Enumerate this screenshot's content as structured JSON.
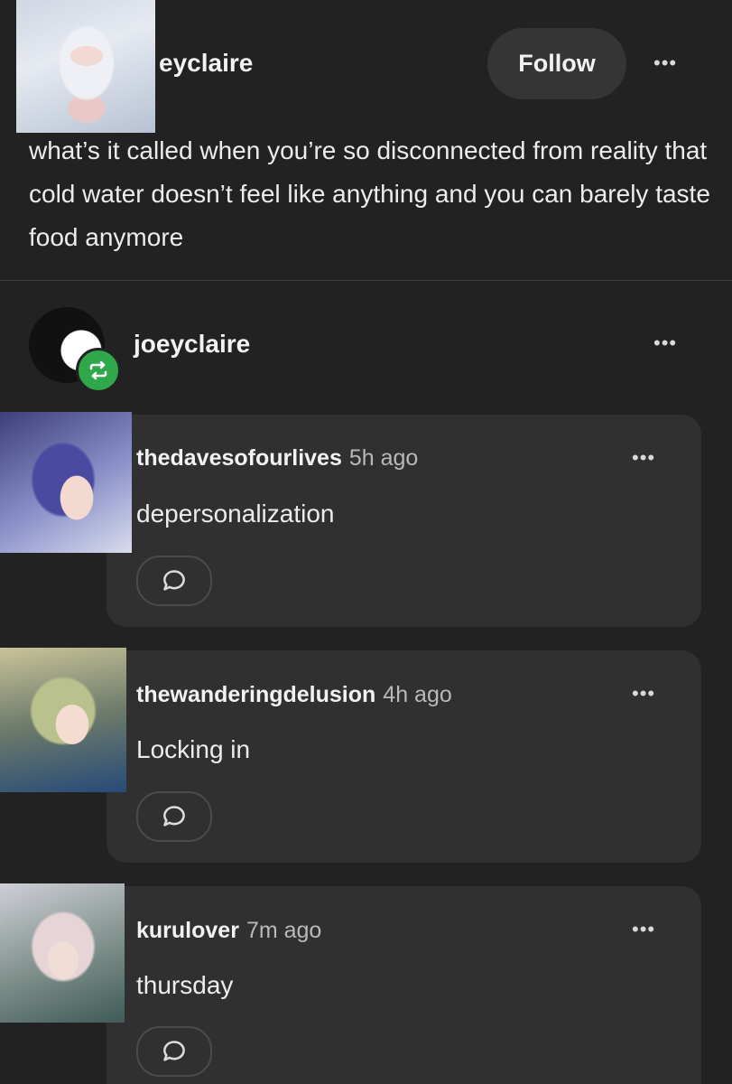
{
  "post": {
    "username": "eyclaire",
    "follow_label": "Follow",
    "more_label": "•••",
    "body": "what’s it called when you’re so disconnected from reality that cold water doesn’t feel like anything and you can barely taste food anymore"
  },
  "reblog": {
    "username": "joeyclaire",
    "badge_icon": "reblog-icon",
    "badge_color": "#2ea84a",
    "more_label": "•••"
  },
  "replies": [
    {
      "username": "thedavesofourlives",
      "time": "5h ago",
      "text": "depersonalization",
      "more_label": "•••"
    },
    {
      "username": "thewanderingdelusion",
      "time": "4h ago",
      "text": "Locking in",
      "more_label": "•••"
    },
    {
      "username": "kurulover",
      "time": "7m ago",
      "text": "thursday",
      "more_label": "•••"
    }
  ]
}
